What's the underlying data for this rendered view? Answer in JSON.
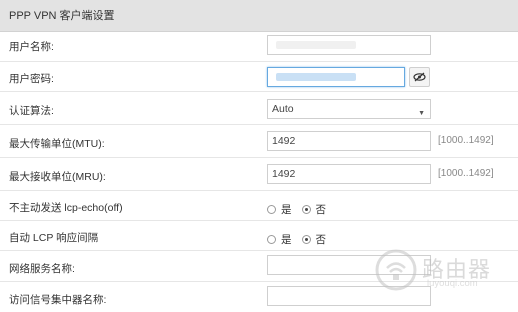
{
  "header": {
    "title": "PPP VPN 客户端设置"
  },
  "rows": {
    "username": {
      "label": "用户名称:",
      "value": ""
    },
    "password": {
      "label": "用户密码:",
      "value": ""
    },
    "auth": {
      "label": "认证算法:",
      "value": "Auto"
    },
    "mtu": {
      "label": "最大传输单位(MTU):",
      "value": "1492",
      "range": "[1000..1492]"
    },
    "mru": {
      "label": "最大接收单位(MRU):",
      "value": "1492",
      "range": "[1000..1492]"
    },
    "lcp_echo": {
      "label": "不主动发送 lcp-echo(off)",
      "opt_yes": "是",
      "opt_no": "否",
      "selected": "否"
    },
    "lcp_interval": {
      "label": "自动 LCP 响应间隔",
      "opt_yes": "是",
      "opt_no": "否",
      "selected": "否"
    },
    "service": {
      "label": "网络服务名称:",
      "value": ""
    },
    "concentrator": {
      "label": "访问信号集中器名称:",
      "value": ""
    }
  },
  "icons": {
    "password_toggle": "eye-slash-icon",
    "select_caret": "chevron-down-icon",
    "watermark_logo": "router-logo"
  },
  "watermark": {
    "text": "路由器",
    "url": "luyouqi.com"
  }
}
